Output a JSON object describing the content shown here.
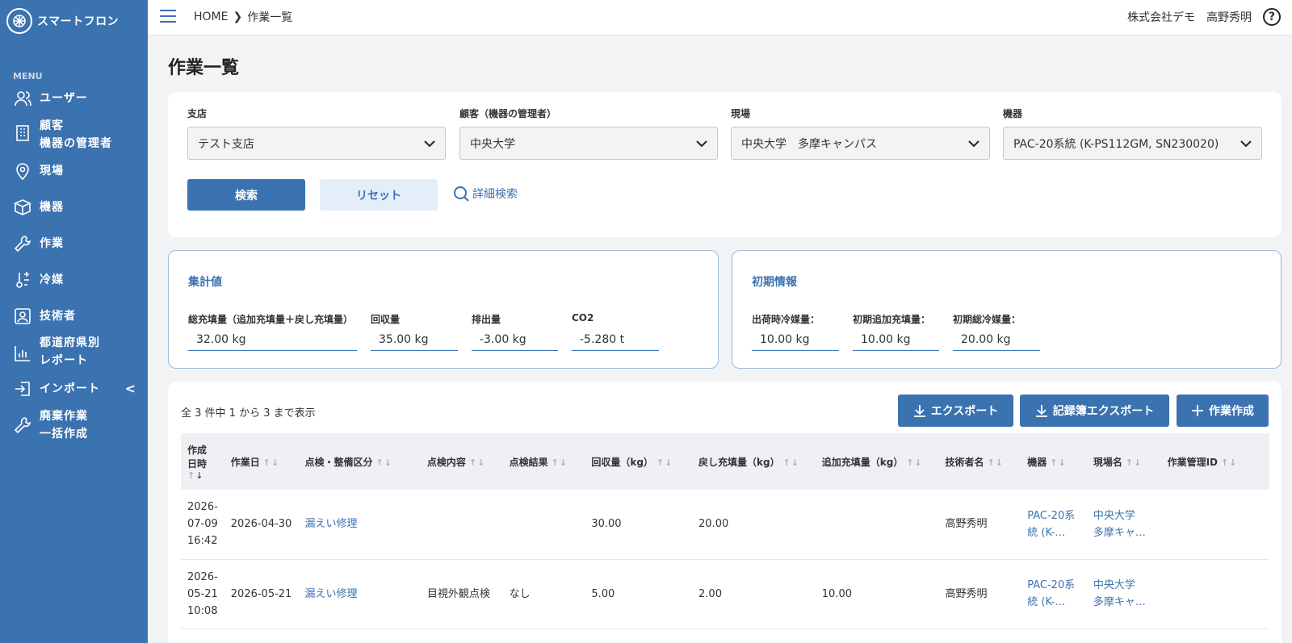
{
  "app": {
    "name": "スマートフロン"
  },
  "sidebar": {
    "menu_heading": "MENU",
    "items": [
      {
        "label": "ユーザー",
        "icon": "user-icon"
      },
      {
        "label": "顧客",
        "label2": "機器の管理者",
        "icon": "building-icon"
      },
      {
        "label": "現場",
        "icon": "map-pin-icon"
      },
      {
        "label": "機器",
        "icon": "box-icon"
      },
      {
        "label": "作業",
        "icon": "wrench-icon"
      },
      {
        "label": "冷媒",
        "icon": "refrigerant-icon"
      },
      {
        "label": "技術者",
        "icon": "technician-icon"
      },
      {
        "label": "都道府県別",
        "label2": "レポート",
        "icon": "bar-chart-icon"
      },
      {
        "label": "インポート",
        "icon": "import-icon",
        "chevron": "<"
      },
      {
        "label": "廃棄作業",
        "label2": "一括作成",
        "icon": "wrench-icon"
      }
    ]
  },
  "header": {
    "breadcrumb": {
      "home": "HOME",
      "current": "作業一覧"
    },
    "company": "株式会社デモ",
    "user": "高野秀明",
    "help": "?"
  },
  "page": {
    "title": "作業一覧"
  },
  "search": {
    "branch": {
      "label": "支店",
      "value": "テスト支店"
    },
    "customer": {
      "label": "顧客（機器の管理者）",
      "value": "中央大学"
    },
    "site": {
      "label": "現場",
      "value": "中央大学　多摩キャンパス"
    },
    "equipment": {
      "label": "機器",
      "value": "PAC-20系統 (K-PS112GM, SN230020)"
    },
    "search_button": "検索",
    "reset_button": "リセット",
    "advanced_link": "詳細検索"
  },
  "totals": {
    "title": "集計値",
    "metrics": [
      {
        "label": "総充填量（追加充填量＋戻し充填量）",
        "value": "32.00 kg"
      },
      {
        "label": "回収量",
        "value": "35.00 kg"
      },
      {
        "label": "排出量",
        "value": "-3.00 kg"
      },
      {
        "label": "CO2",
        "value": "-5.280 t"
      }
    ]
  },
  "initial": {
    "title": "初期情報",
    "metrics": [
      {
        "label": "出荷時冷媒量：",
        "value": "10.00 kg"
      },
      {
        "label": "初期追加充填量：",
        "value": "10.00 kg"
      },
      {
        "label": "初期総冷媒量：",
        "value": "20.00 kg"
      }
    ]
  },
  "list": {
    "count_text": "全 3 件中 1 から 3 まで表示",
    "export_button": "エクスポート",
    "record_export_button": "記録簿エクスポート",
    "create_button": "作業作成",
    "columns": {
      "created": "作成",
      "created2": "日時",
      "work_date": "作業日",
      "category": "点検・整備区分",
      "content": "点検内容",
      "result": "点検結果",
      "recovered": "回収量（kg）",
      "returned": "戻し充填量（kg）",
      "added": "追加充填量（kg）",
      "technician": "技術者名",
      "equipment": "機器",
      "site": "現場名",
      "work_id": "作業管理ID"
    },
    "rows": [
      {
        "created_date": "2026-",
        "created_md": "07-09",
        "created_time": "16:42",
        "work_date": "2026-04-30",
        "category": "漏えい修理",
        "content": "",
        "result": "",
        "recovered": "30.00",
        "returned": "20.00",
        "added": "",
        "technician": "高野秀明",
        "equipment1": "PAC-20系",
        "equipment2": "統 (K-…",
        "site1": "中央大学",
        "site2": "多摩キャ…",
        "work_id": ""
      },
      {
        "created_date": "2026-",
        "created_md": "05-21",
        "created_time": "10:08",
        "work_date": "2026-05-21",
        "category": "漏えい修理",
        "content": "目視外観点検",
        "result": "なし",
        "recovered": "5.00",
        "returned": "2.00",
        "added": "10.00",
        "technician": "高野秀明",
        "equipment1": "PAC-20系",
        "equipment2": "統 (K-…",
        "site1": "中央大学",
        "site2": "多摩キャ…",
        "work_id": ""
      }
    ]
  }
}
